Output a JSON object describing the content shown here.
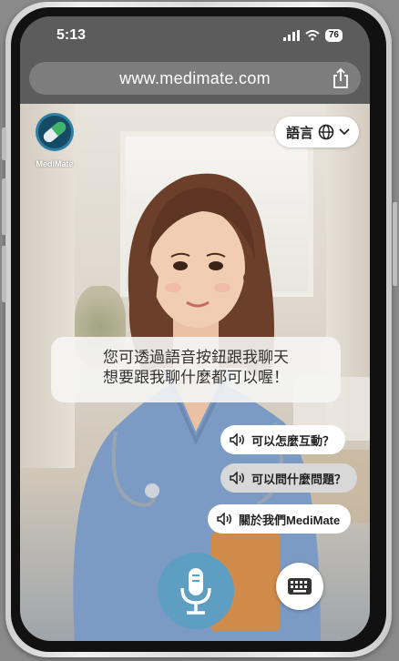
{
  "status_bar": {
    "time": "5:13",
    "battery": "76"
  },
  "browser": {
    "url": "www.medimate.com"
  },
  "brand": {
    "logo_label": "MediMate"
  },
  "language": {
    "label": "語言"
  },
  "greeting": {
    "line1": "您可透過語音按鈕跟我聊天",
    "line2": "想要跟我聊什麼都可以喔！"
  },
  "suggestions": [
    {
      "label": "可以怎麼互動？"
    },
    {
      "label": "可以問什麼問題？"
    },
    {
      "label": "關於我們MediMate"
    }
  ],
  "colors": {
    "mic": "#5e9ec2",
    "scrubs": "#7c9bc4"
  }
}
